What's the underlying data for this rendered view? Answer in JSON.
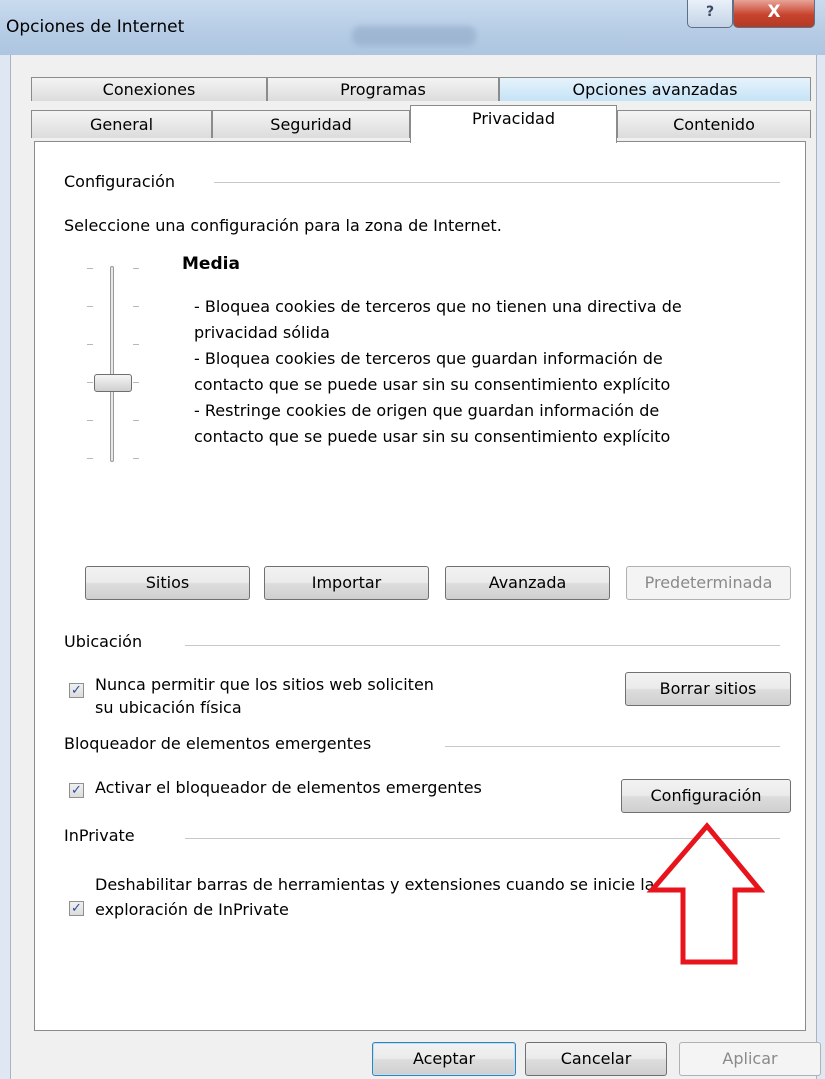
{
  "window": {
    "title": "Opciones de Internet",
    "help_glyph": "?",
    "close_glyph": "X"
  },
  "tabs_row1": [
    {
      "label": "Conexiones"
    },
    {
      "label": "Programas"
    },
    {
      "label": "Opciones avanzadas"
    }
  ],
  "tabs_row2": [
    {
      "label": "General"
    },
    {
      "label": "Seguridad"
    },
    {
      "label": "Privacidad"
    },
    {
      "label": "Contenido"
    }
  ],
  "active_tab": "Privacidad",
  "config": {
    "header": "Configuración",
    "instruction": "Seleccione una configuración para la zona de Internet.",
    "level": "Media",
    "desc_lines": [
      "- Bloquea cookies de terceros que no tienen una directiva de",
      "privacidad sólida",
      "- Bloquea cookies de terceros que guardan información de",
      "contacto que se puede usar sin su consentimiento explícito",
      "- Restringe cookies de origen que guardan información de",
      "contacto que se  puede usar sin su consentimiento explícito"
    ],
    "slider_level": 3,
    "slider_levels": 6,
    "buttons": {
      "sites": "Sitios",
      "import": "Importar",
      "advanced": "Avanzada",
      "default": "Predeterminada"
    }
  },
  "location": {
    "header": "Ubicación",
    "checkbox_line1": "Nunca permitir que los sitios web soliciten",
    "checkbox_line2": "su ubicación física",
    "checked": true,
    "clear_button": "Borrar sitios"
  },
  "popup": {
    "header": "Bloqueador de elementos emergentes",
    "checkbox_label": "Activar el bloqueador de elementos emergentes",
    "checked": true,
    "settings_button": "Configuración"
  },
  "inprivate": {
    "header": "InPrivate",
    "checkbox_line1": "Deshabilitar barras de herramientas y extensiones cuando se inicie la",
    "checkbox_line2": "exploración de InPrivate",
    "checked": true
  },
  "footer": {
    "ok": "Aceptar",
    "cancel": "Cancelar",
    "apply": "Aplicar"
  },
  "annotation": {
    "color": "#e8141c",
    "direction": "up"
  },
  "check_glyph": "✓"
}
